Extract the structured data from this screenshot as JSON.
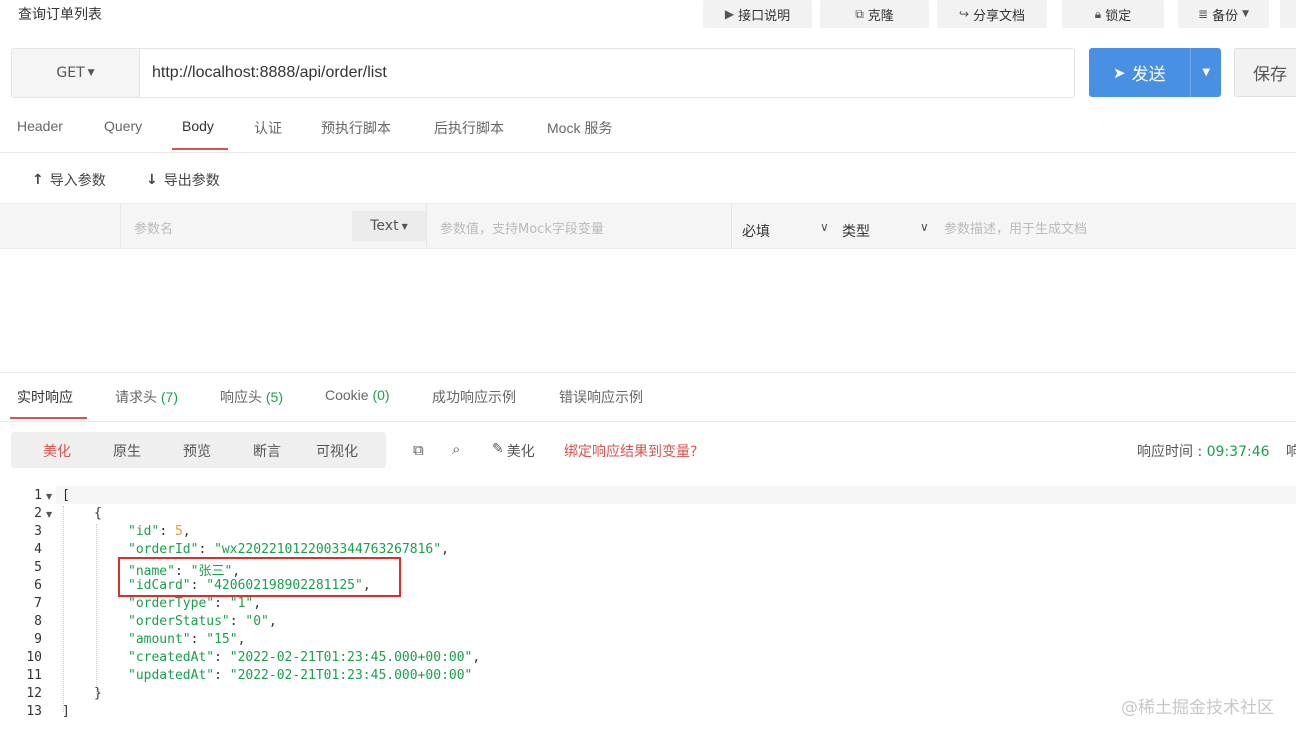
{
  "window": {
    "title": "查询订单列表"
  },
  "topbar": {
    "api_doc": "接口说明",
    "clone": "克隆",
    "share": "分享文档",
    "lock": "锁定",
    "backup": "备份"
  },
  "request": {
    "method": "GET",
    "url": "http://localhost:8888/api/order/list",
    "send_label": "发送",
    "save_label": "保存"
  },
  "request_tabs": [
    "Header",
    "Query",
    "Body",
    "认证",
    "预执行脚本",
    "后执行脚本",
    "Mock 服务"
  ],
  "request_tabs_active": "Body",
  "param_actions": {
    "import": "导入参数",
    "export": "导出参数"
  },
  "param_row": {
    "name_placeholder": "参数名",
    "type": "Text",
    "value_placeholder": "参数值，支持Mock字段变量",
    "required": "必填",
    "kind": "类型",
    "desc_placeholder": "参数描述，用于生成文档"
  },
  "response_tabs": {
    "realtime": "实时响应",
    "req_headers": "请求头",
    "req_headers_count": "(7)",
    "resp_headers": "响应头",
    "resp_headers_count": "(5)",
    "cookie": "Cookie",
    "cookie_count": "(0)",
    "success_example": "成功响应示例",
    "error_example": "错误响应示例"
  },
  "view_modes": [
    "美化",
    "原生",
    "预览",
    "断言",
    "可视化"
  ],
  "view_modes_active": "美化",
  "tools": {
    "beautify": "美化",
    "bind": "绑定响应结果到变量?"
  },
  "response_time": {
    "label": "响应时间 :",
    "value": "09:37:46",
    "trailing": "响"
  },
  "code_lines": [
    {
      "n": "1",
      "fold": true
    },
    {
      "n": "2",
      "fold": true
    },
    {
      "n": "3"
    },
    {
      "n": "4"
    },
    {
      "n": "5"
    },
    {
      "n": "6"
    },
    {
      "n": "7"
    },
    {
      "n": "8"
    },
    {
      "n": "9"
    },
    {
      "n": "10"
    },
    {
      "n": "11"
    },
    {
      "n": "12"
    },
    {
      "n": "13"
    }
  ],
  "json": {
    "open_bracket": "[",
    "open_brace": "{",
    "close_brace": "}",
    "close_bracket": "]",
    "id_key": "\"id\"",
    "id_val": "5",
    "orderId_key": "\"orderId\"",
    "orderId_val": "\"wx2202210122003344763267816\"",
    "name_key": "\"name\"",
    "name_val": "\"张三\"",
    "idCard_key": "\"idCard\"",
    "idCard_val": "\"420602198902281125\"",
    "orderType_key": "\"orderType\"",
    "orderType_val": "\"1\"",
    "orderStatus_key": "\"orderStatus\"",
    "orderStatus_val": "\"0\"",
    "amount_key": "\"amount\"",
    "amount_val": "\"15\"",
    "createdAt_key": "\"createdAt\"",
    "createdAt_val": "\"2022-02-21T01:23:45.000+00:00\"",
    "updatedAt_key": "\"updatedAt\"",
    "updatedAt_val": "\"2022-02-21T01:23:45.000+00:00\""
  },
  "watermark": "@稀土掘金技术社区",
  "colors": {
    "accent": "#d9534f",
    "send": "#4a90e2",
    "json_string": "#1a9e4c",
    "json_number": "#e39a2f",
    "highlight_box": "#d9302c"
  }
}
